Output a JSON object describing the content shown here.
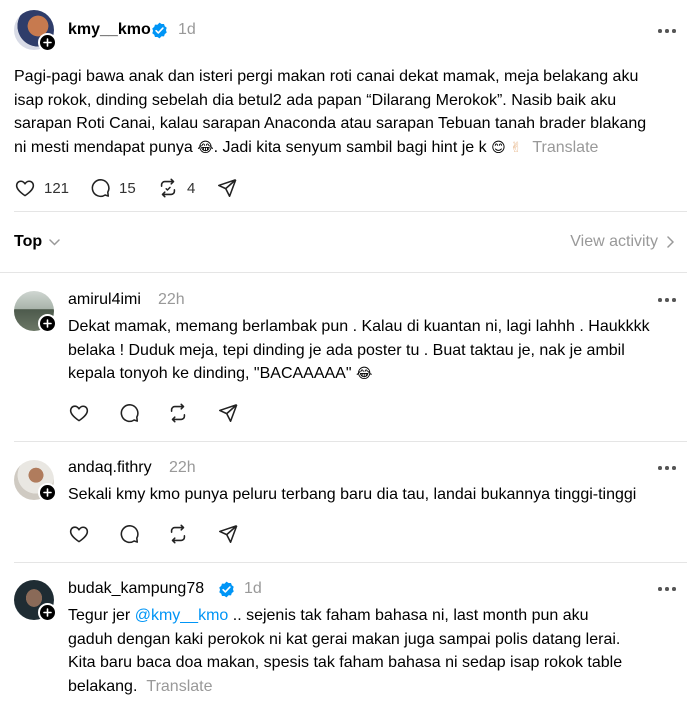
{
  "main_post": {
    "username": "kmy__kmo",
    "time": "1d",
    "lines": [
      "Pagi-pagi bawa anak dan isteri pergi makan roti canai dekat mamak, meja belakang aku",
      "isap rokok, dinding sebelah dia betul2 ada papan “Dilarang Merokok”. Nasib baik aku",
      "sarapan Roti Canai, kalau sarapan Anaconda atau sarapan Tebuan tanah brader blakang",
      "ni mesti mendapat punya",
      ". Jadi kita senyum sambil bagi hint je k"
    ],
    "emoji_laugh": "😂",
    "emoji_smile": "😊",
    "emoji_hand": "✌",
    "translate": "Translate",
    "likes": "121",
    "comments": "15",
    "reposts": "4"
  },
  "sort": {
    "label": "Top",
    "view_activity": "View activity"
  },
  "replies": [
    {
      "username": "amirul4imi",
      "time": "22h",
      "lines": [
        "Dekat mamak, memang berlambak pun . Kalau di kuantan ni, lagi lahhh . Haukkkk",
        "belaka ! Duduk meja, tepi dinding je ada poster tu . Buat taktau je, nak je ambil",
        "kepala tonyoh ke dinding, \"BACAAAAA\""
      ],
      "emoji": "😂"
    },
    {
      "username": "andaq.fithry",
      "time": "22h",
      "lines": [
        "Sekali kmy kmo punya peluru terbang baru dia tau, landai bukannya tinggi-tinggi"
      ]
    },
    {
      "username": "budak_kampung78",
      "time": "1d",
      "prefix": "Tegur jer ",
      "mention": "@kmy__kmo",
      "suffix": " .. sejenis tak faham bahasa ni, last month pun aku",
      "lines": [
        "gaduh dengan kaki perokok ni kat gerai makan juga sampai polis datang lerai.",
        "Kita baru baca doa makan, spesis tak faham bahasa ni sedap isap rokok table",
        "belakang."
      ],
      "translate": "Translate"
    }
  ],
  "colors": {
    "accent_blue": "#0095f6",
    "muted": "#999999",
    "divider": "#e5e5e5"
  },
  "icons": [
    "heart-icon",
    "comment-icon",
    "repost-icon",
    "share-icon",
    "more-icon",
    "verified-icon",
    "plus-icon",
    "chevron-down-icon",
    "chevron-right-icon"
  ]
}
